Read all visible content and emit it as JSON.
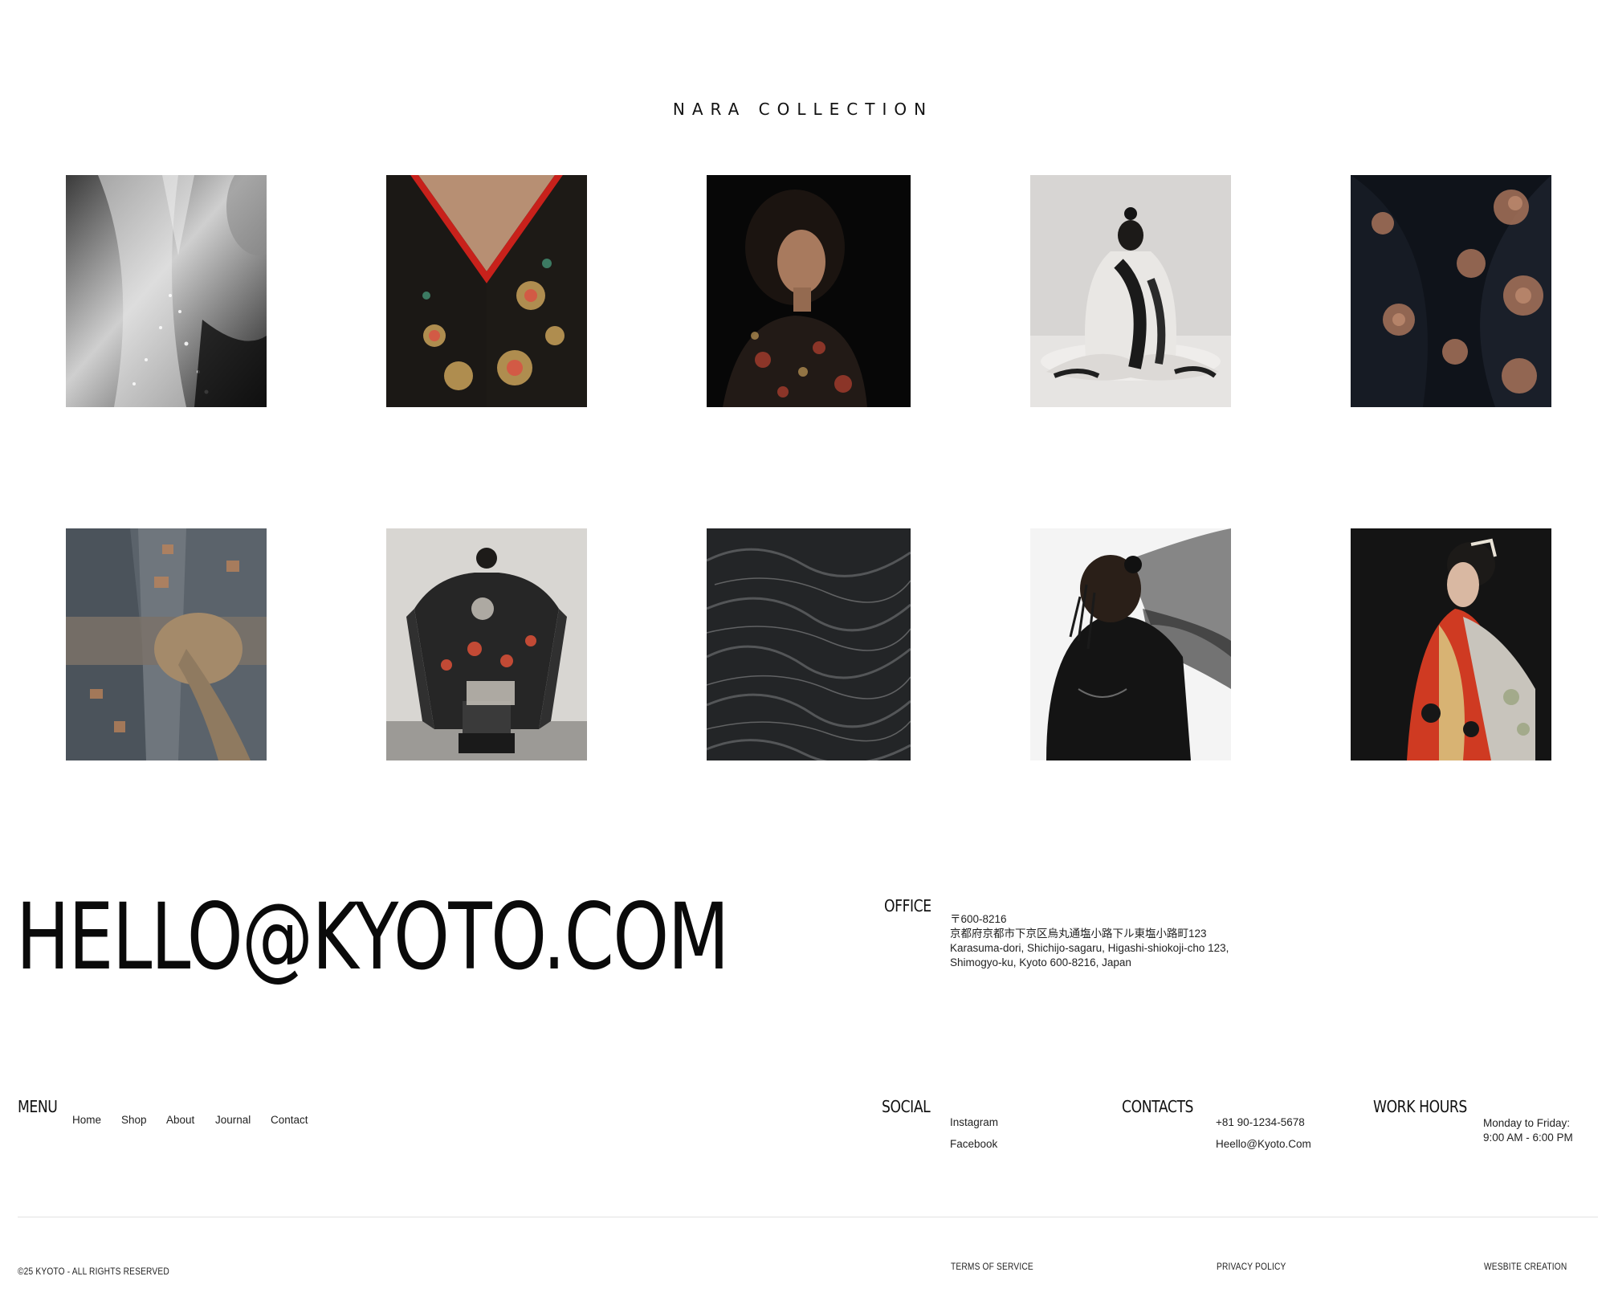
{
  "collection": {
    "title": "NARA COLLECTION"
  },
  "gallery": {
    "items": [
      {
        "name": "gallery-image-1",
        "subject": "embroidered-lace-gown-bw"
      },
      {
        "name": "gallery-image-2",
        "subject": "black-floral-kimono-collar"
      },
      {
        "name": "gallery-image-3",
        "subject": "woman-curly-hair-floral-kimono"
      },
      {
        "name": "gallery-image-4",
        "subject": "seated-figure-white-ink-kimono"
      },
      {
        "name": "gallery-image-5",
        "subject": "dark-silk-gold-floral-fabric"
      },
      {
        "name": "gallery-image-6",
        "subject": "tied-obi-sash-detail"
      },
      {
        "name": "gallery-image-7",
        "subject": "woman-open-painted-kimono"
      },
      {
        "name": "gallery-image-8",
        "subject": "dark-fur-textile-closeup"
      },
      {
        "name": "gallery-image-9",
        "subject": "man-braids-sheer-black-robe"
      },
      {
        "name": "gallery-image-10",
        "subject": "geisha-red-kimono-profile"
      }
    ]
  },
  "contact": {
    "email_display": "HELLO@KYOTO.COM",
    "office_label": "OFFICE",
    "office_lines": [
      "〒600-8216",
      "京都府京都市下京区烏丸通塩小路下ル東塩小路町123",
      "Karasuma-dori, Shichijo-sagaru, Higashi-shiokoji-cho 123,",
      "Shimogyo-ku, Kyoto 600-8216, Japan"
    ]
  },
  "footer": {
    "menu": {
      "label": "MENU",
      "items": [
        "Home",
        "Shop",
        "About",
        "Journal",
        "Contact"
      ]
    },
    "social": {
      "label": "SOCIAL",
      "items": [
        "Instagram",
        "Facebook"
      ]
    },
    "contacts": {
      "label": "CONTACTS",
      "phone": "+81 90-1234-5678",
      "email": "Heello@Kyoto.Com"
    },
    "work_hours": {
      "label": "WORK HOURS",
      "days": "Monday to Friday:",
      "time": "9:00 AM - 6:00 PM"
    },
    "legal": {
      "copyright": "©25 KYOTO - ALL RIGHTS RESERVED",
      "terms": "TERMS OF SERVICE",
      "privacy": "PRIVACY POLICY",
      "credit": "WESBITE CREATION"
    }
  }
}
